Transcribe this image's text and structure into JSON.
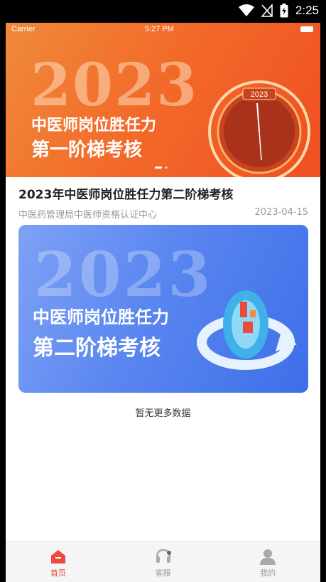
{
  "android_status": {
    "time": "2:25"
  },
  "banner": {
    "ios_carrier": "Carrier",
    "ios_time": "5:27 PM",
    "bg_year": "2023",
    "line1": "中医师岗位胜任力",
    "line2": "第一阶梯考核",
    "clock_year": "2023"
  },
  "article": {
    "title": "2023年中医师岗位胜任力第二阶梯考核",
    "source": "中医药管理局中医师资格认证中心",
    "date": "2023-04-15",
    "card": {
      "bg_year": "2023",
      "line1": "中医师岗位胜任力",
      "line2": "第二阶梯考核"
    }
  },
  "list_end": "暂无更多数据",
  "tabs": [
    {
      "label": "首页",
      "icon": "home-icon",
      "active": true
    },
    {
      "label": "客服",
      "icon": "headset-icon",
      "active": false
    },
    {
      "label": "我的",
      "icon": "user-icon",
      "active": false
    }
  ],
  "colors": {
    "accent": "#e94b3c",
    "banner": "#f26b2a",
    "card": "#4f7ced"
  }
}
